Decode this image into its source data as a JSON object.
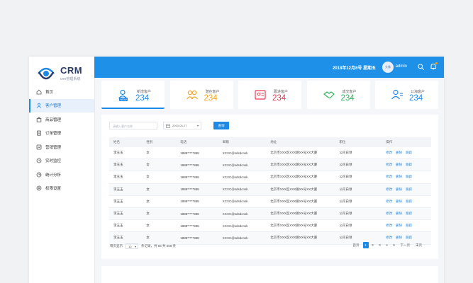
{
  "brand": {
    "name": "CRM",
    "subtitle": "crm管理系统"
  },
  "sidebar": {
    "items": [
      {
        "label": "首页",
        "icon": "home-icon",
        "active": false
      },
      {
        "label": "客户管理",
        "icon": "user-icon",
        "active": true
      },
      {
        "label": "商品管理",
        "icon": "bag-icon",
        "active": false
      },
      {
        "label": "订单管理",
        "icon": "order-icon",
        "active": false
      },
      {
        "label": "营销管理",
        "icon": "chart-icon",
        "active": false
      },
      {
        "label": "实时监控",
        "icon": "monitor-icon",
        "active": false
      },
      {
        "label": "统计分析",
        "icon": "stats-icon",
        "active": false
      },
      {
        "label": "权限设置",
        "icon": "settings-icon",
        "active": false
      }
    ]
  },
  "topbar": {
    "date": "2018年12月8号   星期五",
    "avatar_text": "头像",
    "username": "admin"
  },
  "cards": [
    {
      "label": "新增客户",
      "value": "234",
      "color": "#1e88e5",
      "icon": "new-user-icon",
      "badge": "NEW"
    },
    {
      "label": "潜在客户",
      "value": "234",
      "color": "#f5a623",
      "icon": "group-icon"
    },
    {
      "label": "跟进客户",
      "value": "234",
      "color": "#e53950",
      "icon": "follow-icon"
    },
    {
      "label": "成交客户",
      "value": "234",
      "color": "#2db35d",
      "icon": "handshake-icon"
    },
    {
      "label": "公海客户",
      "value": "234",
      "color": "#1e88e5",
      "icon": "public-user-icon"
    }
  ],
  "filters": {
    "search_placeholder": "请输入客户名称",
    "date_value": "2020-05-27",
    "query_button": "查询"
  },
  "table": {
    "headers": [
      "姓名",
      "性别",
      "电话",
      "邮箱",
      "地址",
      "职位",
      "操作"
    ],
    "rows": [
      [
        "李玉玉",
        "女",
        "1888*****888",
        "XCXC@sdsdcnsk",
        "北京市XXX区XXX路XX号XX大厦",
        "公司白领"
      ],
      [
        "李玉玉",
        "女",
        "1888*****888",
        "XCXC@sdsdcnsk",
        "北京市XXX区XXX路XX号XX大厦",
        "公司白领"
      ],
      [
        "李玉玉",
        "女",
        "1888*****888",
        "XCXC@sdsdcnsk",
        "北京市XXX区XXX路XX号XX大厦",
        "公司白领"
      ],
      [
        "李玉玉",
        "女",
        "1888*****888",
        "XCXC@sdsdcnsk",
        "北京市XXX区XXX路XX号XX大厦",
        "公司白领"
      ],
      [
        "李玉玉",
        "女",
        "1888*****888",
        "XCXC@sdsdcnsk",
        "北京市XXX区XXX路XX号XX大厦",
        "公司白领"
      ],
      [
        "李玉玉",
        "女",
        "1888*****888",
        "XCXC@sdsdcnsk",
        "北京市XXX区XXX路XX号XX大厦",
        "公司白领"
      ],
      [
        "李玉玉",
        "女",
        "1888*****888",
        "XCXC@sdsdcnsk",
        "北京市XXX区XXX路XX号XX大厦",
        "公司白领"
      ],
      [
        "李玉玉",
        "女",
        "1888*****888",
        "XCXC@sdsdcnsk",
        "北京市XXX区XXX路XX号XX大厦",
        "公司白领"
      ]
    ],
    "actions": [
      "修改",
      "删除",
      "跟踪"
    ]
  },
  "pager": {
    "per_page_label": "每页显示",
    "per_page_value": "10",
    "summary": "条记录，共 56 共 558 条",
    "first": "首页",
    "pages": [
      "1",
      "2",
      "3",
      "4",
      "5"
    ],
    "current": "1",
    "next": "下一页",
    "last": "末页"
  },
  "colors": {
    "primary": "#1e90e8",
    "link": "#1e88e5"
  }
}
